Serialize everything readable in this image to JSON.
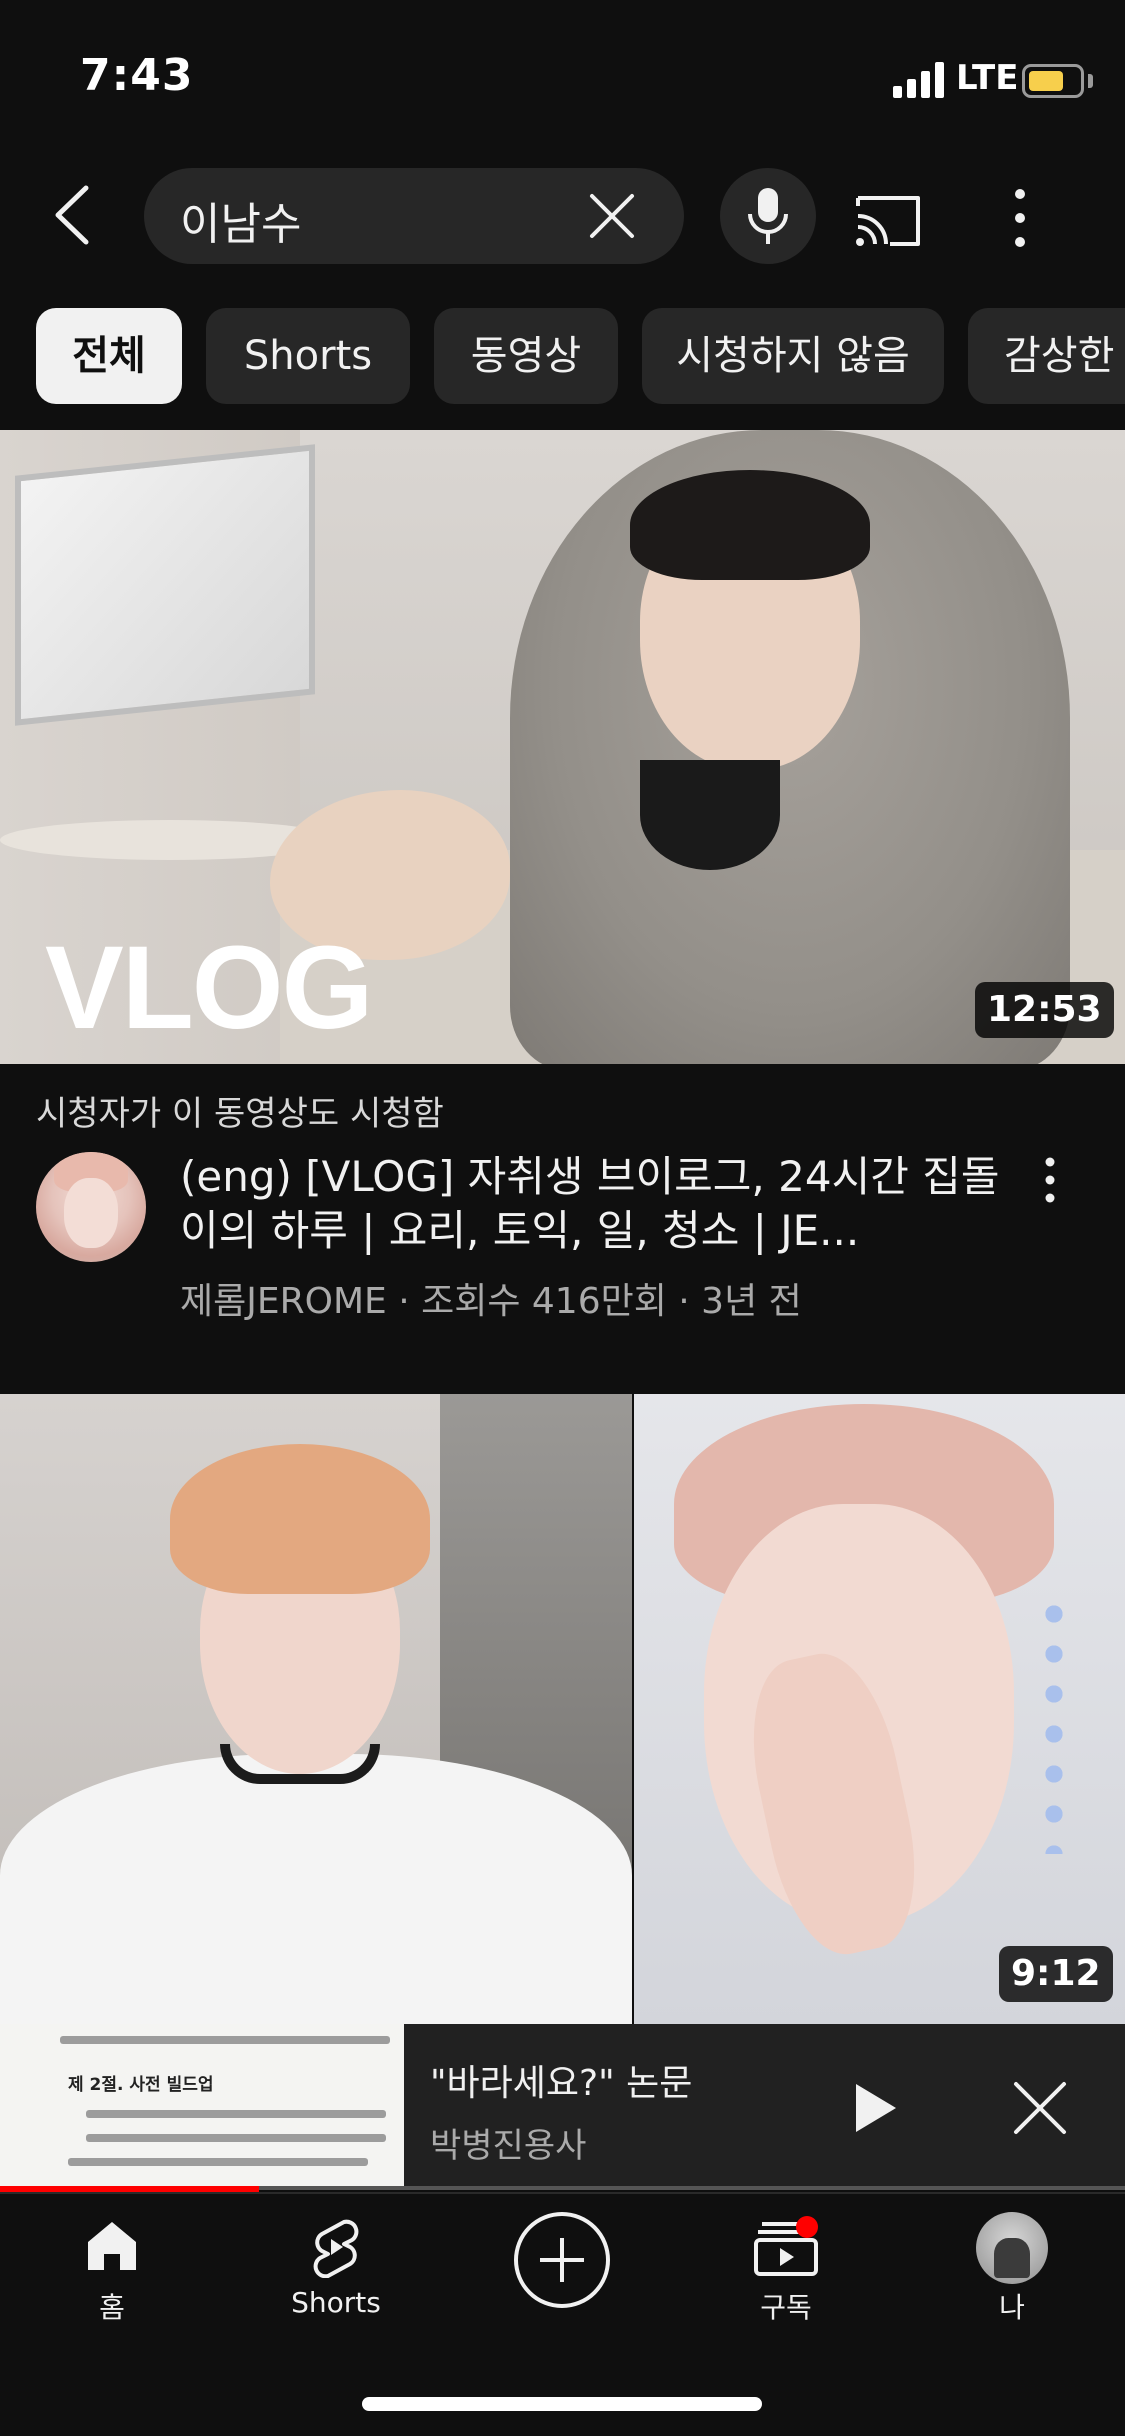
{
  "status_bar": {
    "time": "7:43",
    "network": "LTE"
  },
  "search": {
    "query": "이남수"
  },
  "chips": [
    {
      "label": "전체",
      "active": true
    },
    {
      "label": "Shorts",
      "active": false
    },
    {
      "label": "동영상",
      "active": false
    },
    {
      "label": "시청하지 않음",
      "active": false
    },
    {
      "label": "감상한",
      "active": false
    }
  ],
  "video1": {
    "thumbnail_text": "VLOG",
    "duration": "12:53",
    "note": "시청자가 이 동영상도 시청함",
    "title": "(eng) [VLOG] 자취생 브이로그, 24시간 집돌이의 하루 |  요리, 토익, 일, 청소 | JE...",
    "meta": "제롬JEROME · 조회수 416만회 · 3년 전"
  },
  "video2": {
    "duration": "9:12"
  },
  "mini_player": {
    "title": "\"바라세요?\" 논문",
    "channel": "박병진용사",
    "progress": 0.23,
    "doc_heading": "제 2절. 사전 빌드업"
  },
  "bottom_nav": {
    "home": "홈",
    "shorts": "Shorts",
    "subscriptions": "구독",
    "you": "나"
  },
  "colors": {
    "background": "#0f0f0f",
    "chip": "#272727",
    "accent": "#ff0000"
  }
}
